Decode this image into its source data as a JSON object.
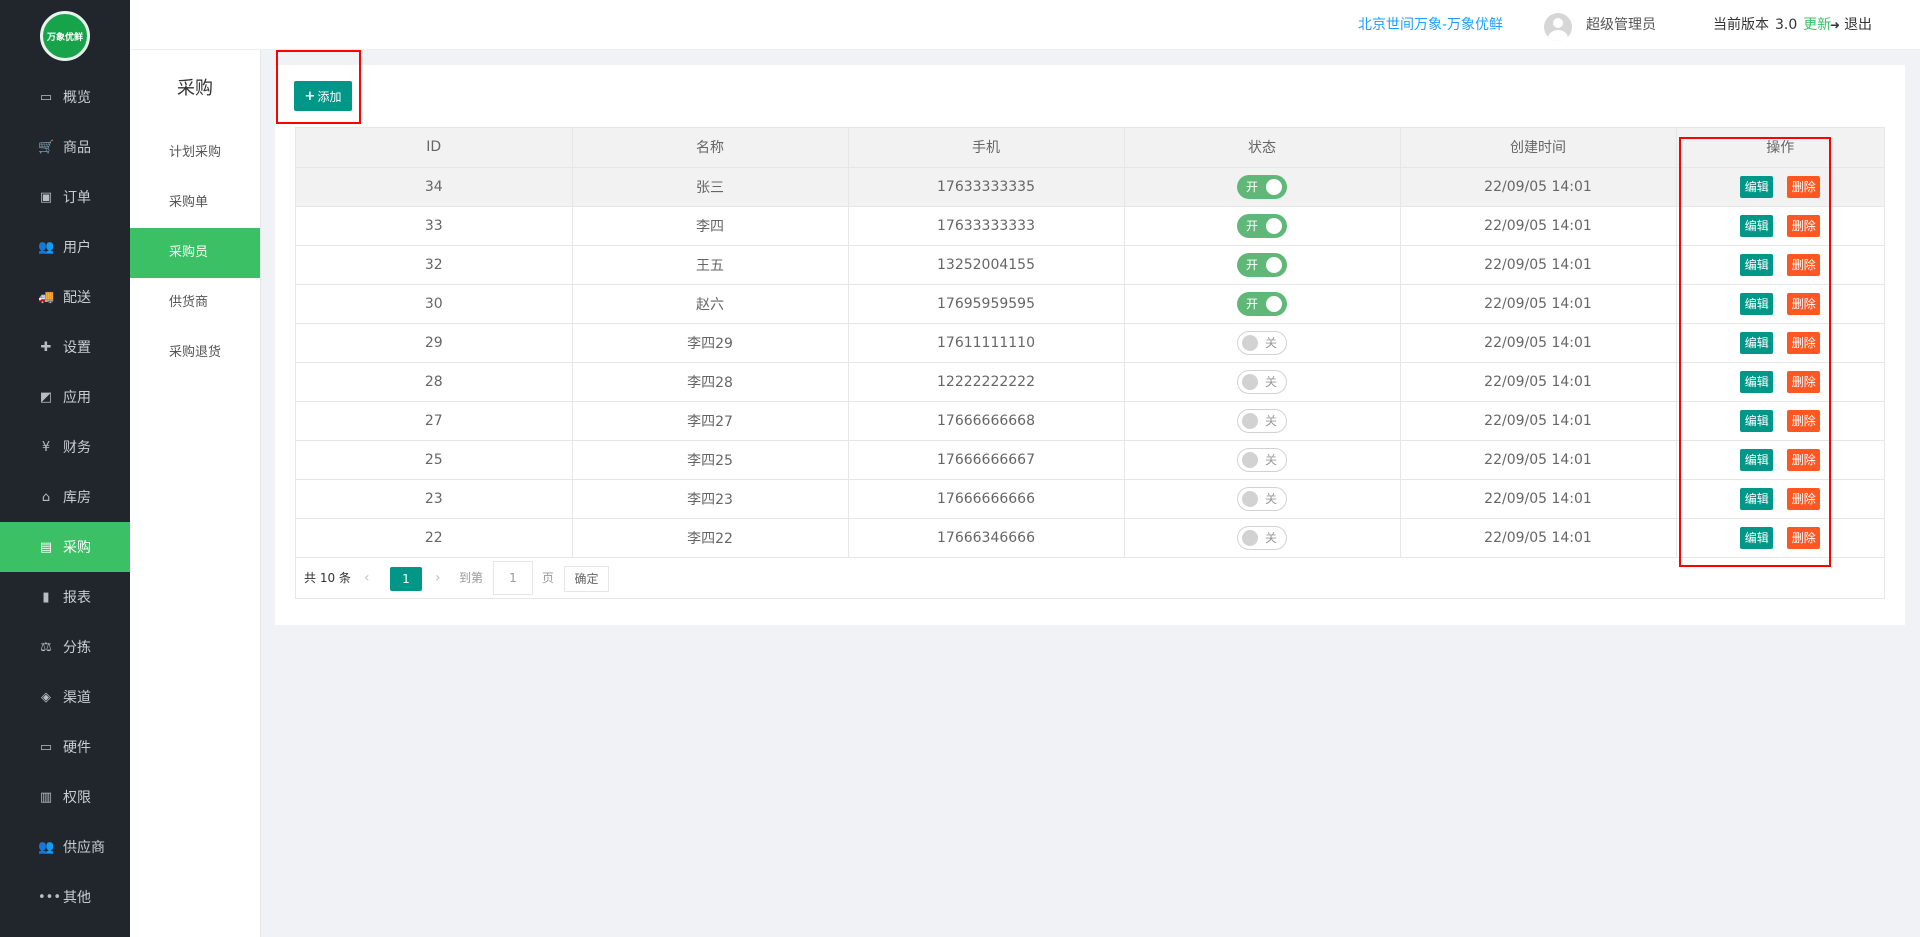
{
  "logo": {
    "text": "万象优鲜"
  },
  "nav": {
    "items": [
      {
        "label": "概览",
        "icon": "▭"
      },
      {
        "label": "商品",
        "icon": "🛒"
      },
      {
        "label": "订单",
        "icon": "▣"
      },
      {
        "label": "用户",
        "icon": "👥"
      },
      {
        "label": "配送",
        "icon": "🚚"
      },
      {
        "label": "设置",
        "icon": "✚"
      },
      {
        "label": "应用",
        "icon": "◩"
      },
      {
        "label": "财务",
        "icon": "¥"
      },
      {
        "label": "库房",
        "icon": "⌂"
      },
      {
        "label": "采购",
        "icon": "▤"
      },
      {
        "label": "报表",
        "icon": "▮"
      },
      {
        "label": "分拣",
        "icon": "⚖"
      },
      {
        "label": "渠道",
        "icon": "◈"
      },
      {
        "label": "硬件",
        "icon": "▭"
      },
      {
        "label": "权限",
        "icon": "▥"
      },
      {
        "label": "供应商",
        "icon": "👥"
      },
      {
        "label": "其他",
        "icon": "•••"
      }
    ],
    "active_index": 9
  },
  "subnav": {
    "title": "采购",
    "items": [
      "计划采购",
      "采购单",
      "采购员",
      "供货商",
      "采购退货"
    ],
    "active_index": 2
  },
  "header": {
    "shop": "北京世间万象-万象优鲜",
    "user": "超级管理员",
    "version_label": "当前版本",
    "version": "3.0",
    "update": "更新",
    "logout": "退出"
  },
  "toolbar": {
    "add_label": "添加"
  },
  "table": {
    "columns": [
      "ID",
      "名称",
      "手机",
      "状态",
      "创建时间",
      "操作"
    ],
    "on_text": "开",
    "off_text": "关",
    "edit_label": "编辑",
    "delete_label": "删除",
    "rows": [
      {
        "id": "34",
        "name": "张三",
        "phone": "17633333335",
        "status": true,
        "time": "22/09/05 14:01"
      },
      {
        "id": "33",
        "name": "李四",
        "phone": "17633333333",
        "status": true,
        "time": "22/09/05 14:01"
      },
      {
        "id": "32",
        "name": "王五",
        "phone": "13252004155",
        "status": true,
        "time": "22/09/05 14:01"
      },
      {
        "id": "30",
        "name": "赵六",
        "phone": "17695959595",
        "status": true,
        "time": "22/09/05 14:01"
      },
      {
        "id": "29",
        "name": "李四29",
        "phone": "17611111110",
        "status": false,
        "time": "22/09/05 14:01"
      },
      {
        "id": "28",
        "name": "李四28",
        "phone": "12222222222",
        "status": false,
        "time": "22/09/05 14:01"
      },
      {
        "id": "27",
        "name": "李四27",
        "phone": "17666666668",
        "status": false,
        "time": "22/09/05 14:01"
      },
      {
        "id": "25",
        "name": "李四25",
        "phone": "17666666667",
        "status": false,
        "time": "22/09/05 14:01"
      },
      {
        "id": "23",
        "name": "李四23",
        "phone": "17666666666",
        "status": false,
        "time": "22/09/05 14:01"
      },
      {
        "id": "22",
        "name": "李四22",
        "phone": "17666346666",
        "status": false,
        "time": "22/09/05 14:01"
      }
    ],
    "highlighted_row": 0
  },
  "pager": {
    "total": "共 10 条",
    "current": "1",
    "goto": "到第",
    "input_value": "1",
    "page": "页",
    "ok": "确定"
  },
  "colors": {
    "nav_bg": "#20262b",
    "accent": "#3cc066",
    "primary_btn": "#009688",
    "danger_btn": "#ff5722",
    "link": "#1e9fff",
    "annotation": "#ff0000"
  }
}
